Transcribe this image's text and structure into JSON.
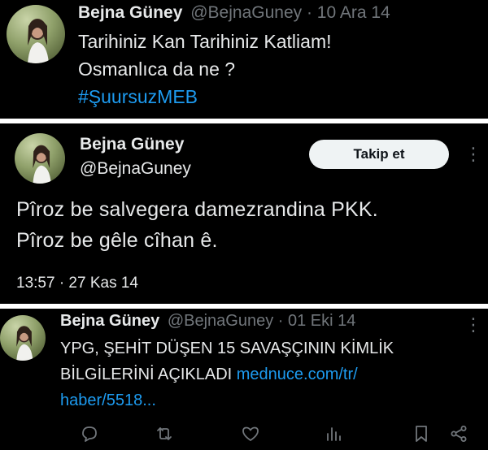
{
  "tweet1": {
    "display_name": "Bejna Güney",
    "handle_time": "@BejnaGuney · 10 Ara 14",
    "lines": [
      "Tarihiniz Kan Tarihiniz Katliam!",
      "Osmanlıca da ne ?"
    ],
    "hashtag": "#ŞuursuzMEB"
  },
  "tweet2": {
    "display_name": "Bejna Güney",
    "handle": "@BejnaGuney",
    "follow_label": "Takip et",
    "more_label": "⋮",
    "lines": [
      "Pîroz be salvegera  damezrandina PKK.",
      "Pîroz be gêle cîhan ê."
    ],
    "timestamp": "13:57 · 27 Kas 14"
  },
  "tweet3": {
    "display_name": "Bejna Güney",
    "handle_time": "@BejnaGuney · 01 Eki 14",
    "more_label": "⋮",
    "line1": "YPG, ŞEHİT DÜŞEN 15 SAVAŞÇININ KİMLİK",
    "line2_text": "BİLGİLERİNİ AÇIKLADI ",
    "line2_link": "mednuce.com/tr/",
    "line3_link": "haber/5518...",
    "actions": [
      "reply-icon",
      "retweet-icon",
      "like-icon",
      "views-icon",
      "bookmark-icon",
      "share-icon"
    ]
  },
  "colors": {
    "background": "#000000",
    "text": "#e7e9ea",
    "muted": "#71767b",
    "link": "#1d9bf0",
    "button_bg": "#eff3f4"
  }
}
